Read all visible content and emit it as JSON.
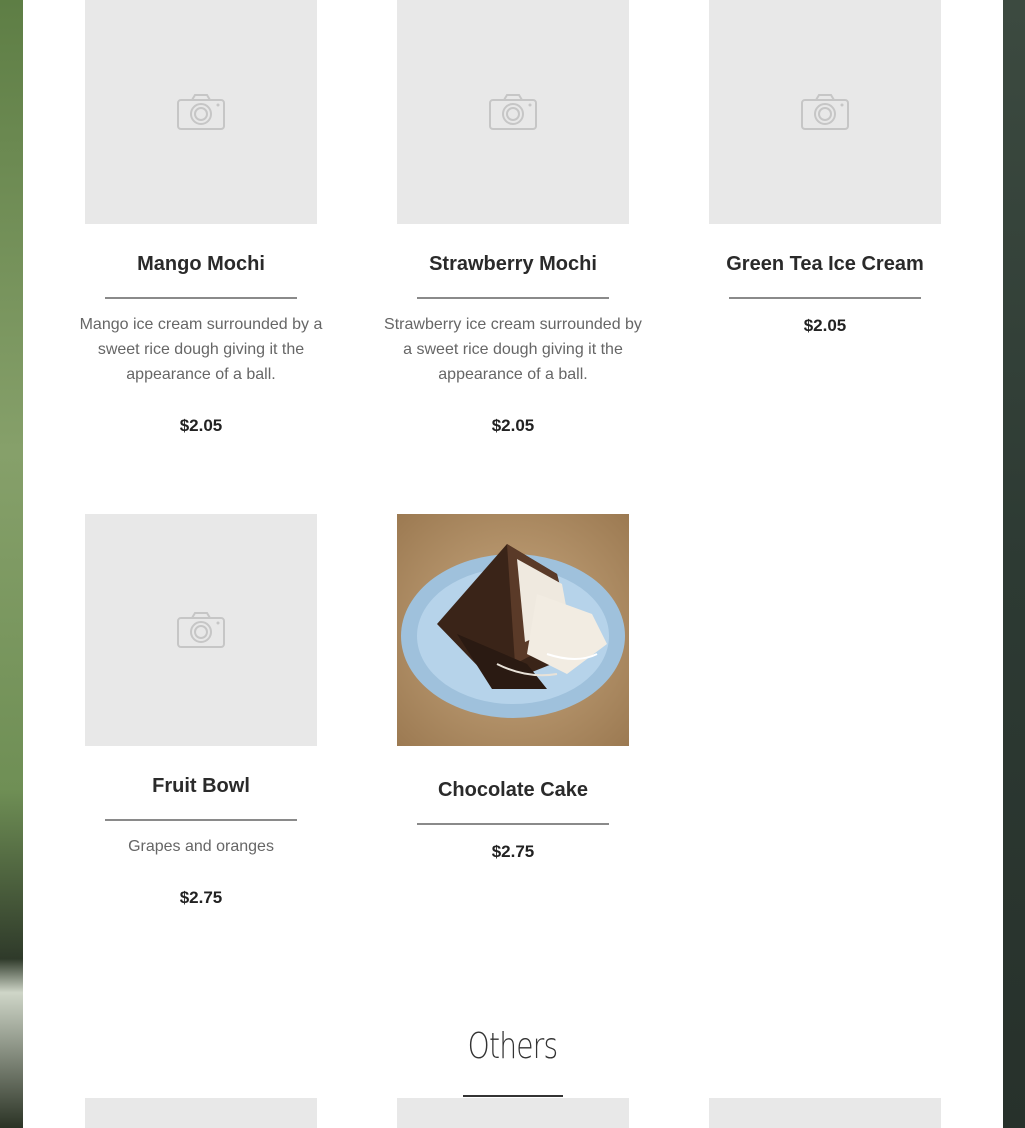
{
  "items": [
    {
      "name": "Mango Mochi",
      "description": "Mango ice cream surrounded by a sweet rice dough giving it the appearance of a ball.",
      "price": "$2.05",
      "image": "camera-placeholder-icon"
    },
    {
      "name": "Strawberry Mochi",
      "description": "Strawberry ice cream surrounded by a sweet rice dough giving it the appearance of a ball.",
      "price": "$2.05",
      "image": "camera-placeholder-icon"
    },
    {
      "name": "Green Tea Ice Cream",
      "description": "",
      "price": "$2.05",
      "image": "camera-placeholder-icon"
    },
    {
      "name": "Fruit Bowl",
      "description": "Grapes and oranges",
      "price": "$2.75",
      "image": "camera-placeholder-icon"
    },
    {
      "name": "Chocolate Cake",
      "description": "",
      "price": "$2.75",
      "image": "chocolate-cake-photo"
    }
  ],
  "sections": {
    "others_title": "Others"
  },
  "colors": {
    "placeholder_bg": "#e8e8e8",
    "rule": "#8a8a8a",
    "text_dark": "#2a2a2a",
    "text_muted": "#666666"
  }
}
